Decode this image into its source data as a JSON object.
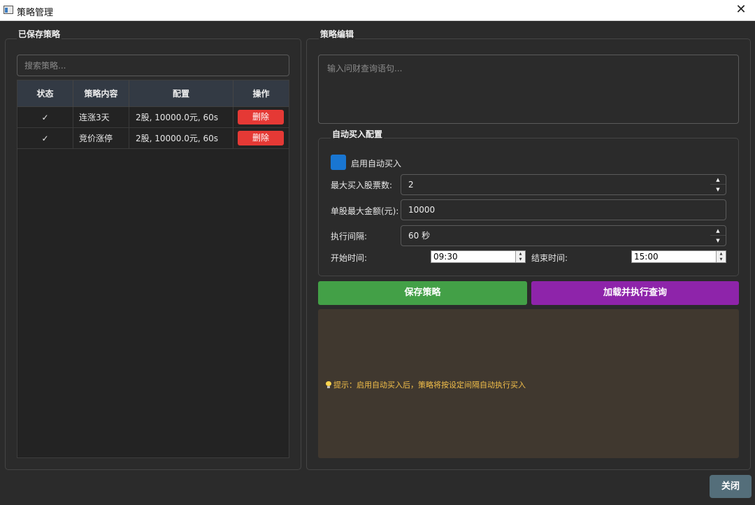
{
  "window": {
    "title": "策略管理"
  },
  "saved": {
    "title": "已保存策略",
    "search_placeholder": "搜索策略...",
    "columns": [
      "状态",
      "策略内容",
      "配置",
      "操作"
    ],
    "rows": [
      {
        "status": "✓",
        "content": "连涨3天",
        "config": "2股, 10000.0元, 60s",
        "action": "删除"
      },
      {
        "status": "✓",
        "content": "竞价涨停",
        "config": "2股, 10000.0元, 60s",
        "action": "删除"
      }
    ]
  },
  "editor": {
    "title": "策略编辑",
    "query_placeholder": "输入问财查询语句..."
  },
  "auto_buy": {
    "title": "自动买入配置",
    "enable_label": "启用自动买入",
    "enabled": true,
    "max_stocks_label": "最大买入股票数:",
    "max_stocks_value": "2",
    "max_amount_label": "单股最大金额(元):",
    "max_amount_value": "10000",
    "interval_label": "执行间隔:",
    "interval_value": "60 秒",
    "start_label": "开始时间:",
    "start_value": "09:30",
    "end_label": "结束时间:",
    "end_value": "15:00"
  },
  "actions": {
    "save": "保存策略",
    "load": "加载并执行查询"
  },
  "output": {
    "tip": "提示：启用自动买入后，策略将按设定间隔自动执行买入"
  },
  "footer": {
    "close": "关闭"
  },
  "colors": {
    "enable_checkbox": "#1976d2",
    "save_button": "#43a047",
    "load_button": "#8e24aa",
    "delete_button": "#e53935",
    "tip_text": "#f4c04a"
  }
}
